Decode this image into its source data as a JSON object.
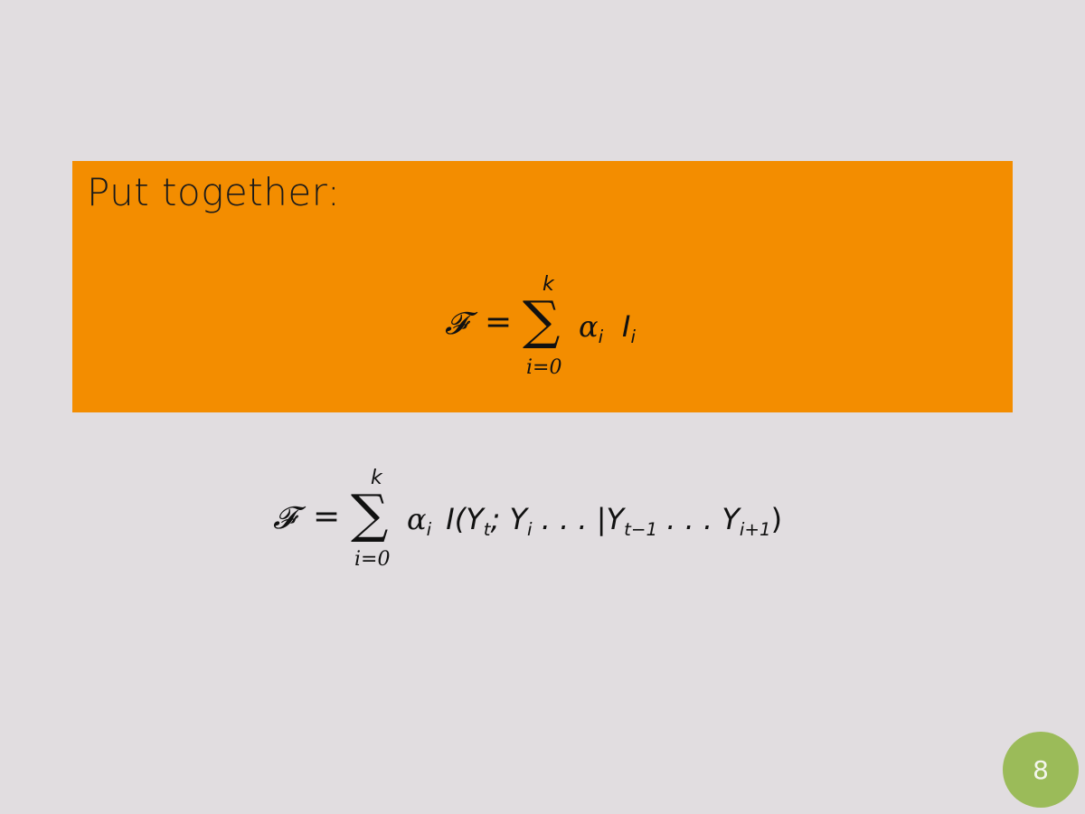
{
  "slide": {
    "block_title": "Put together:",
    "page_number": "8"
  },
  "formula_1": {
    "lhs": "𝓕",
    "eq": "=",
    "sum_symbol": "∑",
    "sum_upper": "k",
    "sum_lower": "i=0",
    "term_alpha": "α",
    "term_alpha_sub": "i",
    "term_I": "I",
    "term_I_sub": "i"
  },
  "formula_2": {
    "lhs": "𝓕",
    "eq": "=",
    "sum_symbol": "∑",
    "sum_upper": "k",
    "sum_lower": "i=0",
    "term_alpha": "α",
    "term_alpha_sub": "i",
    "body_1": "I(Y",
    "body_1_sub": "t",
    "body_2": "; Y",
    "body_2_sub": "i",
    "body_3": " . . . |Y",
    "body_3_sub": "t−1",
    "body_4": " . . . Y",
    "body_4_sub": "i+1",
    "body_5": ")"
  }
}
